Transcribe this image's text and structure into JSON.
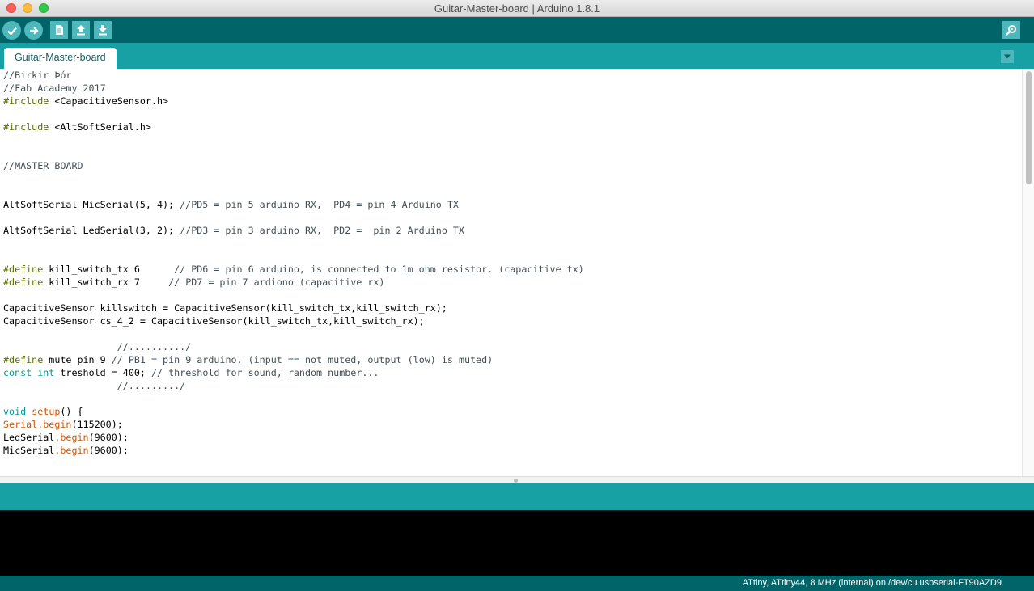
{
  "window": {
    "title": "Guitar-Master-board | Arduino 1.8.1"
  },
  "toolbar": {
    "verify": "verify-icon",
    "upload": "upload-icon",
    "new": "new-file-icon",
    "open": "open-icon",
    "save": "save-icon",
    "serial_monitor": "serial-monitor-icon"
  },
  "tabs": [
    {
      "label": "Guitar-Master-board"
    }
  ],
  "code_lines": [
    "//Birkir Þór",
    "//Fab Academy 2017",
    "#include <CapacitiveSensor.h>",
    "",
    "#include <AltSoftSerial.h>",
    "",
    "",
    "//MASTER BOARD",
    "",
    "",
    "AltSoftSerial MicSerial(5, 4); //PD5 = pin 5 arduino RX,  PD4 = pin 4 Arduino TX",
    "",
    "AltSoftSerial LedSerial(3, 2); //PD3 = pin 3 arduino RX,  PD2 =  pin 2 Arduino TX",
    "",
    "",
    "#define kill_switch_tx 6      // PD6 = pin 6 arduino, is connected to 1m ohm resistor. (capacitive tx)",
    "#define kill_switch_rx 7     // PD7 = pin 7 ardiono (capacitive rx)",
    "",
    "CapacitiveSensor killswitch = CapacitiveSensor(kill_switch_tx,kill_switch_rx);",
    "CapacitiveSensor cs_4_2 = CapacitiveSensor(kill_switch_tx,kill_switch_rx);",
    "",
    "                    //........../",
    "#define mute_pin 9 // PB1 = pin 9 arduino. (input == not muted, output (low) is muted)",
    "const int treshold = 400; // threshold for sound, random number...",
    "                    //........./",
    "",
    "void setup() {",
    "Serial.begin(115200);",
    "LedSerial.begin(9600);",
    "MicSerial.begin(9600);"
  ],
  "status": {
    "board": "ATtiny, ATtiny44, 8 MHz (internal) on /dev/cu.usbserial-FT90AZD9"
  },
  "colors": {
    "toolbar": "#006468",
    "tabbar": "#17a1a5",
    "button": "#4db7bb",
    "console": "#000000"
  }
}
